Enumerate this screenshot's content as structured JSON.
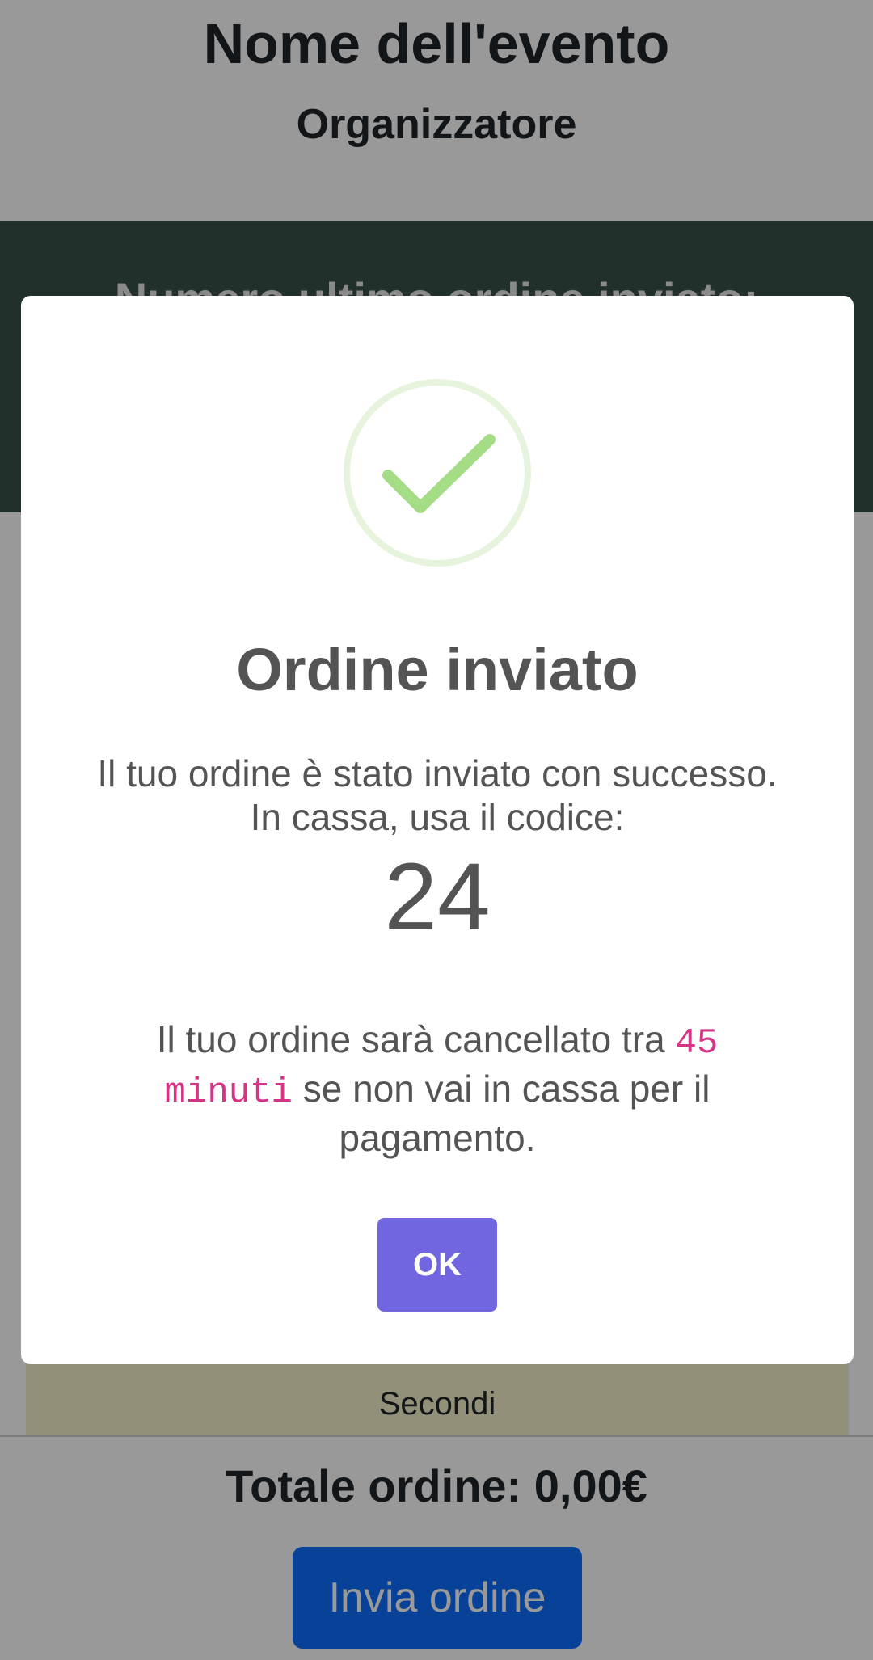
{
  "event": {
    "title": "Nome dell'evento",
    "organizer": "Organizzatore"
  },
  "banner": {
    "last_order_label": "Numero ultimo ordine inviato:"
  },
  "menu": {
    "category": "Secondi"
  },
  "footer": {
    "total_label": "Totale ordine: 0,00€",
    "send_button": "Invia ordine"
  },
  "modal": {
    "icon": "check-circle-icon",
    "title": "Ordine inviato",
    "line1": "Il tuo ordine è stato inviato con successo.",
    "line2": "In cassa, usa il codice:",
    "order_code": "24",
    "cancel_prefix": "Il tuo ordine sarà cancellato tra ",
    "cancel_time": "45 minuti",
    "cancel_suffix": " se non vai in cassa per il pagamento.",
    "ok_button": "OK"
  },
  "colors": {
    "banner": "#385048",
    "category_bg": "#f5f0cc",
    "primary_button": "#0d6efd",
    "ok_button": "#7066e0",
    "success": "#a5dc86",
    "code_highlight": "#d63384"
  }
}
